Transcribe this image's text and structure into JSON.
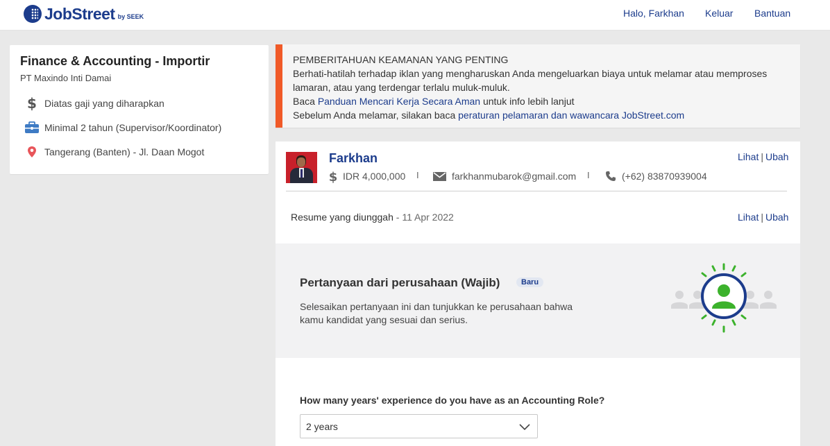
{
  "header": {
    "logo_text": "JobStreet",
    "logo_sub": "by SEEK",
    "greeting": "Halo, Farkhan",
    "logout": "Keluar",
    "help": "Bantuan"
  },
  "job": {
    "title": "Finance & Accounting - Importir",
    "company": "PT Maxindo Inti Damai",
    "salary": "Diatas gaji yang diharapkan",
    "experience": "Minimal 2 tahun (Supervisor/Koordinator)",
    "location": "Tangerang (Banten) - Jl. Daan Mogot"
  },
  "notice": {
    "heading": "PEMBERITAHUAN KEAMANAN YANG PENTING",
    "line1": "Berhati-hatilah terhadap iklan yang mengharuskan Anda mengeluarkan biaya untuk melamar atau memproses",
    "line2": "lamaran, atau yang terdengar terlalu muluk-muluk.",
    "line3_prefix": "Baca ",
    "line3_link": "Panduan Mencari Kerja Secara Aman",
    "line3_suffix": " untuk info lebih lanjut",
    "line4_prefix": "Sebelum Anda melamar, silakan baca ",
    "line4_link": "peraturan pelamaran dan wawancara JobStreet.com"
  },
  "profile": {
    "name": "Farkhan",
    "salary": "IDR 4,000,000",
    "email": "farkhanmubarok@gmail.com",
    "phone": "(+62) 83870939004",
    "separator": "I",
    "view_label": "Lihat",
    "bar": "|",
    "edit_label": "Ubah"
  },
  "resume": {
    "label": "Resume yang diunggah",
    "dash": " - ",
    "date": "11 Apr 2022",
    "view_label": "Lihat",
    "edit_label": "Ubah"
  },
  "questions": {
    "title": "Pertanyaan dari perusahaan (Wajib)",
    "badge": "Baru",
    "desc_line1": "Selesaikan pertanyaan ini dan tunjukkan ke perusahaan bahwa",
    "desc_line2": "kamu kandidat yang sesuai dan serius."
  },
  "form": {
    "question": "How many years' experience do you have as an Accounting Role?",
    "selected": "2 years"
  },
  "icons": {
    "dollar": "dollar-icon",
    "briefcase": "briefcase-icon",
    "location": "location-pin-icon",
    "email": "envelope-icon",
    "phone": "phone-icon",
    "chevron": "chevron-down-icon"
  },
  "colors": {
    "brand": "#1c3c8c",
    "notice_accent": "#f05a28",
    "briefcase": "#3e7bc4",
    "pin": "#e8555a",
    "illus_green": "#3cb22c"
  }
}
